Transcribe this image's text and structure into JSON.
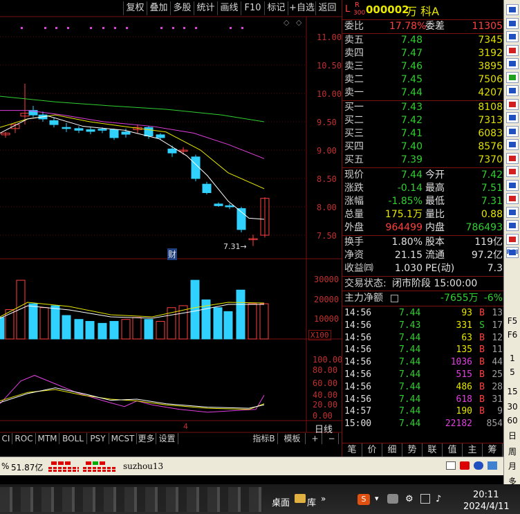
{
  "toolbar": {
    "buttons": [
      "复权",
      "叠加",
      "多股",
      "统计",
      "画线",
      "F10",
      "标记",
      "+自选",
      "返回"
    ]
  },
  "price_axis": [
    "11.00",
    "10.50",
    "10.00",
    "9.50",
    "9.00",
    "8.50",
    "8.00",
    "7.50"
  ],
  "volume_axis": [
    "30000",
    "20000",
    "10000"
  ],
  "volume_unit": "X100",
  "indicator_axis": [
    "100.00",
    "80.00",
    "60.00",
    "40.00",
    "20.00",
    "0.00"
  ],
  "chart_labels": {
    "low_marker": "7.31",
    "cai_badge": "财",
    "date_tick": "4",
    "period": "日线"
  },
  "bottom_tabs": [
    "CI",
    "ROC",
    "MTM",
    "BOLL",
    "PSY",
    "MCST",
    "更多",
    "设置"
  ],
  "bottom_right": {
    "indicator": "指标B",
    "template": "模板",
    "plus": "+",
    "minus": "−"
  },
  "stock": {
    "flag_l": "L",
    "flag_r": "R",
    "flag_num": "300",
    "code": "000002",
    "name": "万 科A"
  },
  "quote": {
    "weibi_label": "委比",
    "weibi": "17.78%",
    "weicha_label": "委差",
    "weicha": "11305",
    "asks": [
      {
        "label": "卖五",
        "price": "7.48",
        "vol": "7345"
      },
      {
        "label": "卖四",
        "price": "7.47",
        "vol": "3192"
      },
      {
        "label": "卖三",
        "price": "7.46",
        "vol": "3895"
      },
      {
        "label": "卖二",
        "price": "7.45",
        "vol": "7506"
      },
      {
        "label": "卖一",
        "price": "7.44",
        "vol": "4207"
      }
    ],
    "bids": [
      {
        "label": "买一",
        "price": "7.43",
        "vol": "8108"
      },
      {
        "label": "买二",
        "price": "7.42",
        "vol": "7313"
      },
      {
        "label": "买三",
        "price": "7.41",
        "vol": "6083"
      },
      {
        "label": "买四",
        "price": "7.40",
        "vol": "8576"
      },
      {
        "label": "买五",
        "price": "7.39",
        "vol": "7370"
      }
    ],
    "stats": [
      {
        "l1": "现价",
        "v1": "7.44",
        "c1": "green",
        "l2": "今开",
        "v2": "7.42",
        "c2": "green"
      },
      {
        "l1": "涨跌",
        "v1": "-0.14",
        "c1": "green",
        "l2": "最高",
        "v2": "7.51",
        "c2": "green"
      },
      {
        "l1": "涨幅",
        "v1": "-1.85%",
        "c1": "green",
        "l2": "最低",
        "v2": "7.31",
        "c2": "green"
      },
      {
        "l1": "总量",
        "v1": "175.1万",
        "c1": "yellow",
        "l2": "量比",
        "v2": "0.88",
        "c2": "yellow"
      },
      {
        "l1": "外盘",
        "v1": "964499",
        "c1": "red",
        "l2": "内盘",
        "v2": "786493",
        "c2": "green"
      }
    ],
    "fundamentals": [
      {
        "l1": "换手",
        "v1": "1.80%",
        "l2": "股本",
        "v2": "119亿"
      },
      {
        "l1": "净资",
        "v1": "21.15",
        "l2": "流通",
        "v2": "97.2亿"
      },
      {
        "l1": "收益㈣",
        "v1": "1.030",
        "l2": "PE(动)",
        "v2": "7.3"
      }
    ],
    "status_label": "交易状态:",
    "status_value": "闭市阶段 15:00:00",
    "main_flow_label": "主力净额",
    "main_flow_value": "-7655万",
    "main_flow_pct": "-6%"
  },
  "trades": [
    {
      "t": "14:56",
      "p": "7.44",
      "v": "93",
      "vc": "yellow",
      "s": "B",
      "sc": "red",
      "n": "13"
    },
    {
      "t": "14:56",
      "p": "7.43",
      "v": "331",
      "vc": "yellow",
      "s": "S",
      "sc": "green",
      "n": "17"
    },
    {
      "t": "14:56",
      "p": "7.44",
      "v": "63",
      "vc": "yellow",
      "s": "B",
      "sc": "red",
      "n": "12"
    },
    {
      "t": "14:56",
      "p": "7.44",
      "v": "135",
      "vc": "yellow",
      "s": "B",
      "sc": "red",
      "n": "11"
    },
    {
      "t": "14:56",
      "p": "7.44",
      "v": "1036",
      "vc": "magenta",
      "s": "B",
      "sc": "red",
      "n": "44"
    },
    {
      "t": "14:56",
      "p": "7.44",
      "v": "515",
      "vc": "magenta",
      "s": "B",
      "sc": "red",
      "n": "25"
    },
    {
      "t": "14:56",
      "p": "7.44",
      "v": "486",
      "vc": "yellow",
      "s": "B",
      "sc": "red",
      "n": "28"
    },
    {
      "t": "14:56",
      "p": "7.44",
      "v": "618",
      "vc": "magenta",
      "s": "B",
      "sc": "red",
      "n": "31"
    },
    {
      "t": "14:57",
      "p": "7.44",
      "v": "190",
      "vc": "yellow",
      "s": "B",
      "sc": "red",
      "n": "9"
    },
    {
      "t": "15:00",
      "p": "7.44",
      "v": "22182",
      "vc": "magenta",
      "s": "",
      "sc": "red",
      "n": "854"
    }
  ],
  "bottom_nav": [
    "笔",
    "价",
    "细",
    "势",
    "联",
    "值",
    "主",
    "筹"
  ],
  "side_toolbar": [
    "RSI",
    "F5",
    "F6",
    "1",
    "5",
    "15",
    "30",
    "60",
    "日",
    "周",
    "月",
    "多"
  ],
  "status_bar": {
    "pct": "%",
    "amount": "51.87亿",
    "user": "suzhou13"
  },
  "taskbar": {
    "desktop": "桌面",
    "lib": "库",
    "time": "20:11",
    "date": "2024/4/11"
  },
  "colors": {
    "up": "#ff4040",
    "down": "#30d0ff",
    "ma5": "#ffffff",
    "ma10": "#e8e800",
    "ma20": "#e040e0",
    "ma60": "#30d030"
  }
}
